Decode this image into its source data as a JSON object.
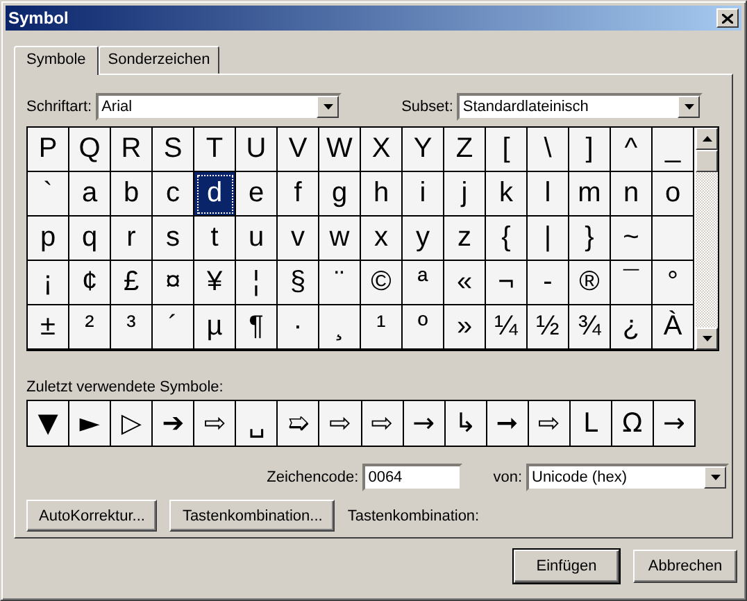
{
  "window": {
    "title": "Symbol"
  },
  "tabs": [
    {
      "label": "Symbole",
      "selected": true
    },
    {
      "label": "Sonderzeichen",
      "selected": false
    }
  ],
  "font": {
    "label": "Schriftart:",
    "value": "Arial"
  },
  "subset": {
    "label": "Subset:",
    "value": "Standardlateinisch"
  },
  "symbol_grid": [
    [
      {
        "char": "P",
        "selected": false
      },
      {
        "char": "Q",
        "selected": false
      },
      {
        "char": "R",
        "selected": false
      },
      {
        "char": "S",
        "selected": false
      },
      {
        "char": "T",
        "selected": false
      },
      {
        "char": "U",
        "selected": false
      },
      {
        "char": "V",
        "selected": false
      },
      {
        "char": "W",
        "selected": false
      },
      {
        "char": "X",
        "selected": false
      },
      {
        "char": "Y",
        "selected": false
      },
      {
        "char": "Z",
        "selected": false
      },
      {
        "char": "[",
        "selected": false
      },
      {
        "char": "\\",
        "selected": false
      },
      {
        "char": "]",
        "selected": false
      },
      {
        "char": "^",
        "selected": false
      },
      {
        "char": "_",
        "selected": false
      }
    ],
    [
      {
        "char": "`",
        "selected": false
      },
      {
        "char": "a",
        "selected": false
      },
      {
        "char": "b",
        "selected": false
      },
      {
        "char": "c",
        "selected": false
      },
      {
        "char": "d",
        "selected": true
      },
      {
        "char": "e",
        "selected": false
      },
      {
        "char": "f",
        "selected": false
      },
      {
        "char": "g",
        "selected": false
      },
      {
        "char": "h",
        "selected": false
      },
      {
        "char": "i",
        "selected": false
      },
      {
        "char": "j",
        "selected": false
      },
      {
        "char": "k",
        "selected": false
      },
      {
        "char": "l",
        "selected": false
      },
      {
        "char": "m",
        "selected": false
      },
      {
        "char": "n",
        "selected": false
      },
      {
        "char": "o",
        "selected": false
      }
    ],
    [
      {
        "char": "p",
        "selected": false
      },
      {
        "char": "q",
        "selected": false
      },
      {
        "char": "r",
        "selected": false
      },
      {
        "char": "s",
        "selected": false
      },
      {
        "char": "t",
        "selected": false
      },
      {
        "char": "u",
        "selected": false
      },
      {
        "char": "v",
        "selected": false
      },
      {
        "char": "w",
        "selected": false
      },
      {
        "char": "x",
        "selected": false
      },
      {
        "char": "y",
        "selected": false
      },
      {
        "char": "z",
        "selected": false
      },
      {
        "char": "{",
        "selected": false
      },
      {
        "char": "|",
        "selected": false
      },
      {
        "char": "}",
        "selected": false
      },
      {
        "char": "~",
        "selected": false
      },
      {
        "selected": false
      }
    ],
    [
      {
        "char": "¡",
        "selected": false
      },
      {
        "char": "¢",
        "selected": false
      },
      {
        "char": "£",
        "selected": false
      },
      {
        "char": "¤",
        "selected": false
      },
      {
        "char": "¥",
        "selected": false
      },
      {
        "char": "¦",
        "selected": false
      },
      {
        "char": "§",
        "selected": false
      },
      {
        "char": "¨",
        "selected": false
      },
      {
        "char": "©",
        "selected": false
      },
      {
        "char": "ª",
        "selected": false
      },
      {
        "char": "«",
        "selected": false
      },
      {
        "char": "¬",
        "selected": false
      },
      {
        "char": "-",
        "selected": false
      },
      {
        "char": "®",
        "selected": false
      },
      {
        "char": "¯",
        "selected": false
      },
      {
        "char": "°",
        "selected": false
      }
    ],
    [
      {
        "char": "±",
        "selected": false
      },
      {
        "char": "²",
        "selected": false
      },
      {
        "char": "³",
        "selected": false
      },
      {
        "char": "´",
        "selected": false
      },
      {
        "char": "µ",
        "selected": false
      },
      {
        "char": "¶",
        "selected": false
      },
      {
        "char": "·",
        "selected": false
      },
      {
        "char": "¸",
        "selected": false
      },
      {
        "char": "¹",
        "selected": false
      },
      {
        "char": "º",
        "selected": false
      },
      {
        "char": "»",
        "selected": false
      },
      {
        "char": "¼",
        "selected": false
      },
      {
        "char": "½",
        "selected": false
      },
      {
        "char": "¾",
        "selected": false
      },
      {
        "char": "¿",
        "selected": false
      },
      {
        "char": "À",
        "selected": false
      }
    ]
  ],
  "recent": {
    "label": "Zuletzt verwendete Symbole:",
    "symbols": [
      "▼",
      "►",
      "▷",
      "➔",
      "⇨",
      "␣",
      "➯",
      "⇨",
      "⇨",
      "→",
      "↳",
      "➞",
      "⇨",
      "L",
      "Ω",
      "→"
    ]
  },
  "char_code": {
    "label": "Zeichencode:",
    "value": "0064"
  },
  "from": {
    "label": "von:",
    "value": "Unicode (hex)"
  },
  "buttons_left": [
    {
      "label": "AutoKorrektur..."
    },
    {
      "label": "Tastenkombination..."
    }
  ],
  "shortcut_label": "Tastenkombination:",
  "buttons_bottom": [
    {
      "label": "Einfügen",
      "default": true
    },
    {
      "label": "Abbrechen",
      "default": false
    }
  ]
}
